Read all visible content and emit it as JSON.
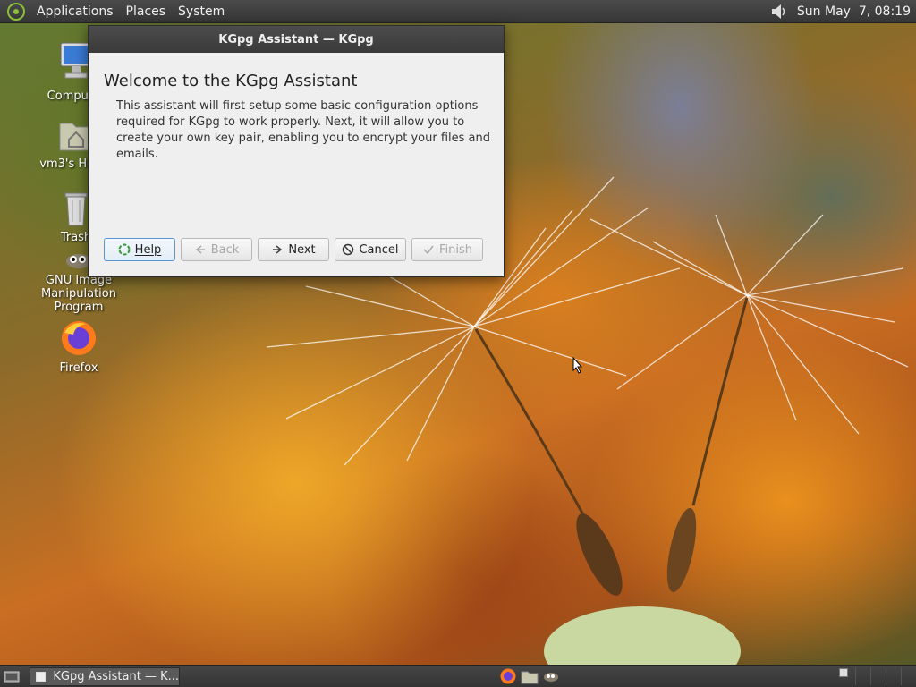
{
  "top_panel": {
    "menus": [
      "Applications",
      "Places",
      "System"
    ],
    "clock": "Sun May  7, 08:19"
  },
  "desktop_icons": [
    {
      "label": "Computer",
      "icon": "computer-icon"
    },
    {
      "label": "vm3's Home",
      "icon": "home-folder-icon"
    },
    {
      "label": "Trash",
      "icon": "trash-icon"
    },
    {
      "label": "GNU Image Manipulation Program",
      "icon": "gimp-icon"
    },
    {
      "label": "Firefox",
      "icon": "firefox-icon"
    }
  ],
  "dialog": {
    "title": "KGpg Assistant — KGpg",
    "heading": "Welcome to the KGpg Assistant",
    "body": "This assistant will first setup some basic configuration options required for KGpg to work properly. Next, it will allow you to create your own key pair, enabling you to encrypt your files and emails.",
    "buttons": {
      "help": "Help",
      "back": "Back",
      "next": "Next",
      "cancel": "Cancel",
      "finish": "Finish"
    }
  },
  "taskbar": {
    "task_label": "KGpg Assistant — K..."
  },
  "colors": {
    "panel": "#3c3c3c",
    "dialog_bg": "#efefef",
    "focus": "#5a96d4"
  }
}
